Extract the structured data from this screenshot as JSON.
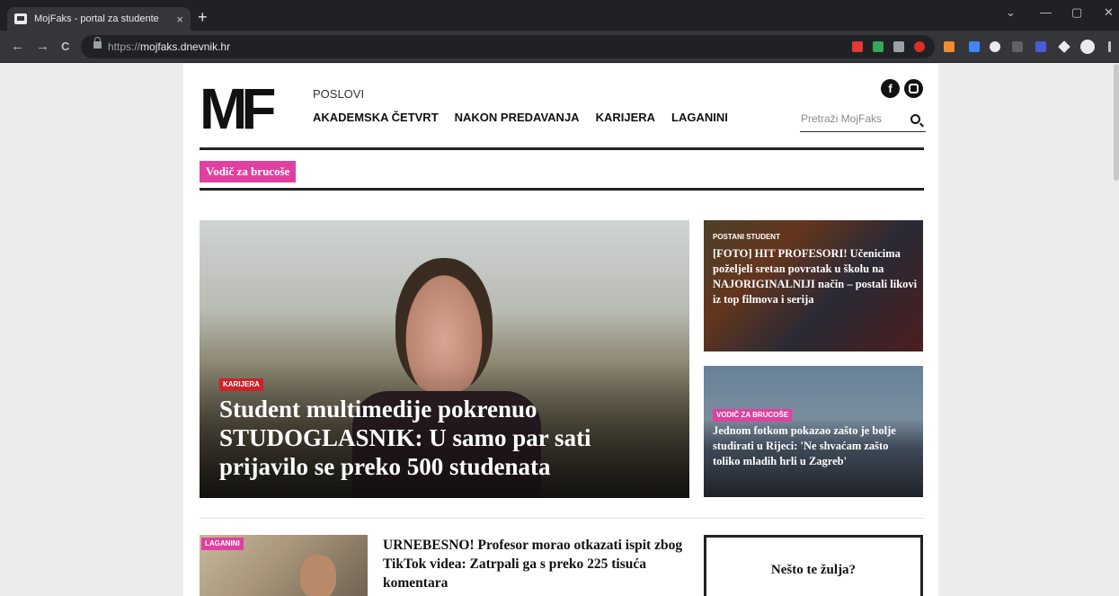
{
  "browser": {
    "tab_title": "MojFaks - portal za studente",
    "tab_close": "×",
    "new_tab": "+",
    "url_prefix": "https://",
    "url_host": "mojfaks.dnevnik.hr",
    "back": "←",
    "forward": "→",
    "reload": "C",
    "share_icon": "⇪",
    "star_icon": "☆",
    "minimize": "—",
    "maximize": "▢",
    "close": "✕",
    "chevron": "⌄"
  },
  "site": {
    "logo": "MF",
    "top_link": "POSLOVI",
    "nav": [
      "AKADEMSKA ČETVRT",
      "NAKON PREDAVANJA",
      "KARIJERA",
      "LAGANINI"
    ],
    "facebook": "f",
    "search_placeholder": "Pretraži MojFaks",
    "tag_button": "Vodič za brucoše"
  },
  "hero": {
    "label": "KARIJERA",
    "title": "Student multimedije pokrenuo STUDOGLASNIK: U samo par sati prijavilo se preko 500 studenata"
  },
  "cards": [
    {
      "label": "POSTANI STUDENT",
      "title": "[FOTO] HIT PROFESORI! Učenicima poželjeli sretan povratak u školu na NAJORIGINALNIJI način – postali likovi iz top filmova i serija"
    },
    {
      "label": "VODIČ ZA BRUCOŠE",
      "title": "Jednom fotkom pokazao zašto je bolje studirati u Rijeci: 'Ne shvaćam zašto toliko mladih hrli u Zagreb'"
    }
  ],
  "article": {
    "label": "LAGANINI",
    "title": "URNEBESNO! Profesor morao otkazati ispit zbog TikTok videa: Zatrpali ga s preko 225 tisuća komentara"
  },
  "widget": {
    "title": "Nešto te žulja?"
  },
  "colors": {
    "accent": "#e040a0",
    "karijera_label": "#d0202a",
    "chrome_dark": "#202124",
    "chrome_toolbar": "#35363a"
  }
}
